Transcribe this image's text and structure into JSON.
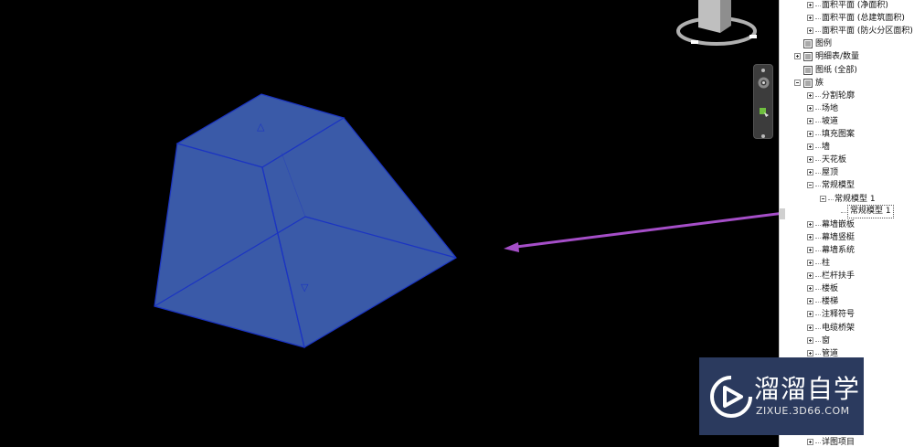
{
  "viewport": {
    "shape_color": "#3a5aa8",
    "edge_color": "#1b34c2",
    "arrow_color": "#a54ec8",
    "background": "#000000",
    "marker_up": "△",
    "marker_down": "▽"
  },
  "viewcube": {
    "cube_color": "#bfbfbf",
    "ring_color": "#b0b0b0"
  },
  "navbar": {
    "buttons": [
      "steering-wheel-icon",
      "zoom-icon"
    ]
  },
  "browser": {
    "rows": [
      {
        "label": "面积平面 (净面积)",
        "toggle": "plus"
      },
      {
        "label": "面积平面 (总建筑面积)",
        "toggle": "plus"
      },
      {
        "label": "面积平面 (防火分区面积)",
        "toggle": "plus"
      },
      {
        "label": "图例",
        "toggle": "none",
        "icon": "legend-icon"
      },
      {
        "label": "明细表/数量",
        "toggle": "plus",
        "icon": "schedule-icon"
      },
      {
        "label": "图纸 (全部)",
        "toggle": "none",
        "icon": "sheet-icon"
      },
      {
        "label": "族",
        "toggle": "minus",
        "icon": "family-icon"
      },
      {
        "label": "分割轮廓",
        "toggle": "plus"
      },
      {
        "label": "场地",
        "toggle": "plus"
      },
      {
        "label": "坡道",
        "toggle": "plus"
      },
      {
        "label": "填充图案",
        "toggle": "plus"
      },
      {
        "label": "墙",
        "toggle": "plus"
      },
      {
        "label": "天花板",
        "toggle": "plus"
      },
      {
        "label": "屋顶",
        "toggle": "plus"
      },
      {
        "label": "常规模型",
        "toggle": "minus"
      },
      {
        "label": "常规模型 1",
        "toggle": "minus"
      },
      {
        "label": "常规模型 1",
        "toggle": "none",
        "selected": true
      },
      {
        "label": "幕墙嵌板",
        "toggle": "plus"
      },
      {
        "label": "幕墙竖梃",
        "toggle": "plus"
      },
      {
        "label": "幕墙系统",
        "toggle": "plus"
      },
      {
        "label": "柱",
        "toggle": "plus"
      },
      {
        "label": "栏杆扶手",
        "toggle": "plus"
      },
      {
        "label": "楼板",
        "toggle": "plus"
      },
      {
        "label": "楼梯",
        "toggle": "plus"
      },
      {
        "label": "注释符号",
        "toggle": "plus"
      },
      {
        "label": "电缆桥架",
        "toggle": "plus"
      },
      {
        "label": "窗",
        "toggle": "plus"
      },
      {
        "label": "管道",
        "toggle": "plus"
      },
      {
        "label": "详图项目",
        "toggle": "plus"
      }
    ]
  },
  "watermark": {
    "title": "溜溜自学",
    "subtitle": "ZIXUE.3D66.COM",
    "color": "#2b3a5e"
  }
}
